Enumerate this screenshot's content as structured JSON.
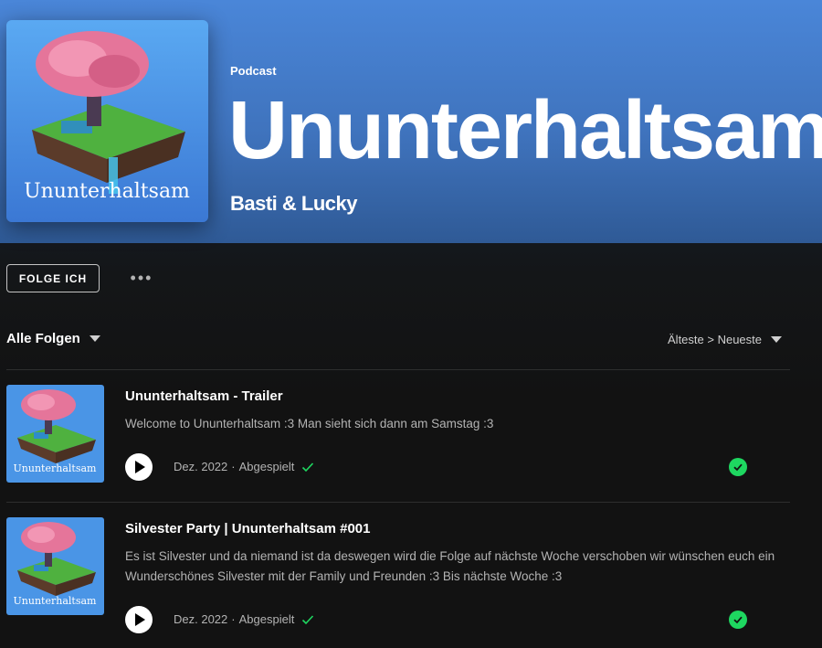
{
  "header": {
    "type_label": "Podcast",
    "title": "Ununterhaltsam",
    "author": "Basti & Lucky",
    "cover_text": "Ununterhaltsam",
    "accent_color": "#4a86d8"
  },
  "actions": {
    "follow_label": "FOLGE ICH",
    "more_label": "•••",
    "more_icon": "more-horizontal-icon"
  },
  "filter": {
    "label": "Alle Folgen",
    "sort_label": "Älteste > Neueste"
  },
  "episodes": [
    {
      "title": "Ununterhaltsam - Trailer",
      "description": "Welcome to Ununterhaltsam :3 Man sieht sich dann am Samstag :3",
      "date": "Dez. 2022",
      "separator": "·",
      "status": "Abgespielt",
      "thumb_text": "Ununterhaltsam"
    },
    {
      "title": "Silvester Party | Ununterhaltsam #001",
      "description": "Es ist Silvester und da niemand ist da deswegen wird die Folge auf nächste Woche verschoben wir wünschen euch ein Wunderschönes Silvester mit der Family und Freunden :3 Bis nächste Woche :3",
      "date": "Dez. 2022",
      "separator": "·",
      "status": "Abgespielt",
      "thumb_text": "Ununterhaltsam"
    }
  ],
  "colors": {
    "played_green": "#1ed760",
    "text_muted": "#b3b3b3"
  }
}
